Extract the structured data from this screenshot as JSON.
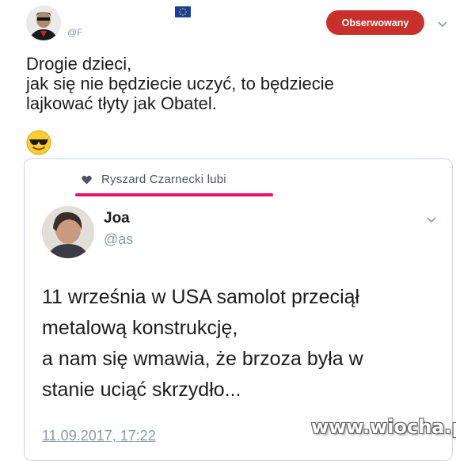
{
  "header": {
    "handle": "@F",
    "follow_label": "Obserwowany",
    "chevron_icon": "chevron-down-icon",
    "flag_icon": "eu-flag-icon"
  },
  "tweet": {
    "lines": [
      "Drogie dzieci,",
      "jak się nie będziecie uczyć, to będziecie",
      "lajkować tłyty jak Obatel."
    ],
    "emoji_icon": "sunglasses-emoji-icon"
  },
  "quoted": {
    "liked_by": "Ryszard Czarnecki lubi",
    "heart_icon": "heart-icon",
    "highlight_color": "#e6136e",
    "author_name": "Joa",
    "author_handle": "@as",
    "lines": [
      "11 września w USA samolot przeciął",
      "metalową konstrukcję,",
      "a nam się wmawia, że brzoza była w",
      "stanie uciąć skrzydło..."
    ],
    "date": "11.09.2017, 17:22"
  },
  "watermark": "www.wiocha.pl",
  "colors": {
    "follow_button": "#c9302c",
    "secondary_text": "#8899a6"
  }
}
